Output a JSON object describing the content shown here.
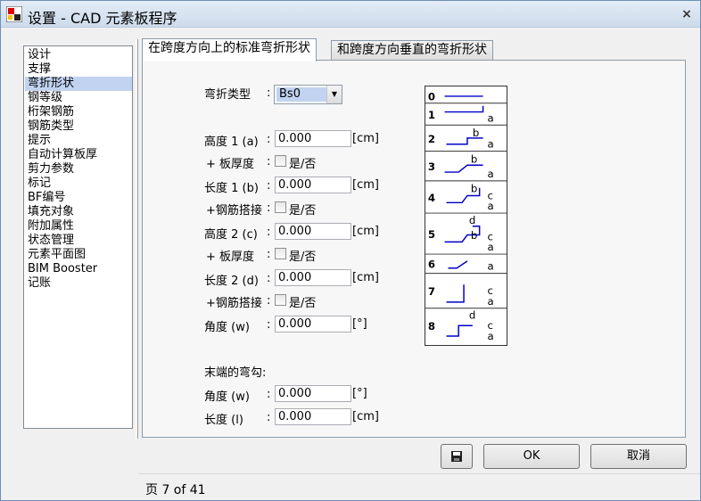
{
  "window": {
    "title": "设置  -  CAD 元素板程序",
    "close_glyph": "×"
  },
  "nav": {
    "items": [
      "设计",
      "支撑",
      "弯折形状",
      "钢等级",
      "桁架钢筋",
      "钢筋类型",
      "提示",
      "自动计算板厚",
      "剪力参数",
      "标记",
      "BF编号",
      "填充对象",
      "附加属性",
      "状态管理",
      "元素平面图",
      "BIM Booster",
      "记账"
    ],
    "selected_index": 2
  },
  "tabs": [
    {
      "label": "在跨度方向上的标准弯折形状",
      "active": true
    },
    {
      "label": "和跨度方向垂直的弯折形状",
      "active": false
    }
  ],
  "form": {
    "bend_type": {
      "label": "弯折类型",
      "value": "Bs0"
    },
    "height1": {
      "label": "高度 1 (a)",
      "value": "0.000",
      "unit": "[cm]"
    },
    "plus_slab": {
      "label": "+ 板厚度",
      "option": "是/否"
    },
    "length1": {
      "label": "长度 1 (b)",
      "value": "0.000",
      "unit": "[cm]"
    },
    "plus_lap": {
      "label": "+钢筋搭接",
      "option": "是/否"
    },
    "height2": {
      "label": "高度 2 (c)",
      "value": "0.000",
      "unit": "[cm]"
    },
    "plus_slab2": {
      "label": "+ 板厚度",
      "option": "是/否"
    },
    "length2": {
      "label": "长度 2 (d)",
      "value": "0.000",
      "unit": "[cm]"
    },
    "plus_lap2": {
      "label": "+钢筋搭接",
      "option": "是/否"
    },
    "angle": {
      "label": "角度 (w)",
      "value": "0.000",
      "unit": "[°]"
    },
    "end_hook_title": "末端的弯勾:",
    "end_angle": {
      "label": "角度 (w)",
      "value": "0.000",
      "unit": "[°]"
    },
    "end_length": {
      "label": "长度  (l)",
      "value": "0.000",
      "unit": "[cm]"
    },
    "colon": ":"
  },
  "shapes": {
    "rows": [
      {
        "num": "0",
        "labels": []
      },
      {
        "num": "1",
        "labels": [
          "a"
        ]
      },
      {
        "num": "2",
        "labels": [
          "b",
          "a"
        ]
      },
      {
        "num": "3",
        "labels": [
          "b",
          "a"
        ]
      },
      {
        "num": "4",
        "labels": [
          "b",
          "c",
          "a"
        ]
      },
      {
        "num": "5",
        "labels": [
          "d",
          "b",
          "c",
          "a"
        ]
      },
      {
        "num": "6",
        "labels": [
          "a"
        ]
      },
      {
        "num": "7",
        "labels": [
          "c",
          "a"
        ]
      },
      {
        "num": "8",
        "labels": [
          "d",
          "c",
          "a"
        ]
      }
    ],
    "line_color": "#0000c8"
  },
  "buttons": {
    "save_icon": "save-icon",
    "ok": "OK",
    "cancel": "取消"
  },
  "status": {
    "page_text": "页 7  of 41"
  }
}
